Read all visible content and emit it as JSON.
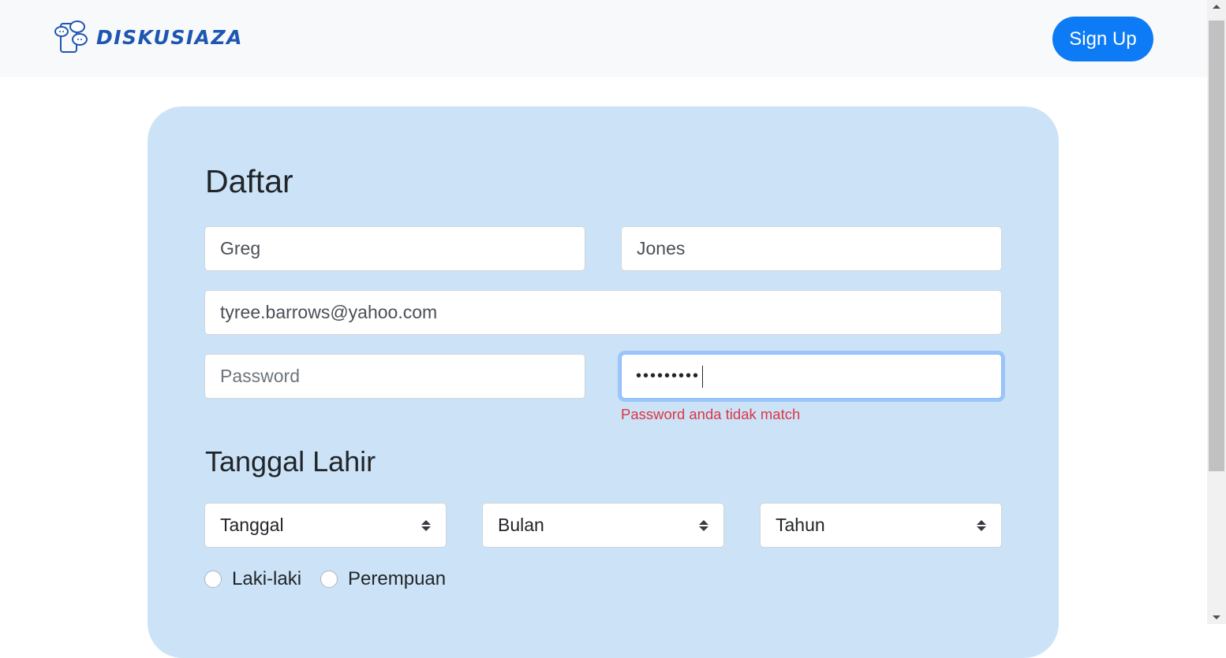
{
  "header": {
    "brand": "DISKUSIAZA",
    "logo_icon": "chat-bubbles-phone-icon",
    "signup_label": "Sign Up",
    "signup_color": "#0d7bf5"
  },
  "form": {
    "title": "Daftar",
    "first_name": {
      "value": "Greg"
    },
    "last_name": {
      "value": "Jones"
    },
    "email": {
      "value": "tyree.barrows@yahoo.com"
    },
    "password": {
      "value": "",
      "placeholder": "Password"
    },
    "confirm_password": {
      "masked_value": "•••••••••"
    },
    "error_message": "Password anda tidak match",
    "error_color": "#dc3545",
    "birthdate": {
      "title": "Tanggal Lahir",
      "day": "Tanggal",
      "month": "Bulan",
      "year": "Tahun"
    },
    "gender": {
      "options": [
        "Laki-laki",
        "Perempuan"
      ]
    },
    "card_color": "#cce3f7"
  }
}
